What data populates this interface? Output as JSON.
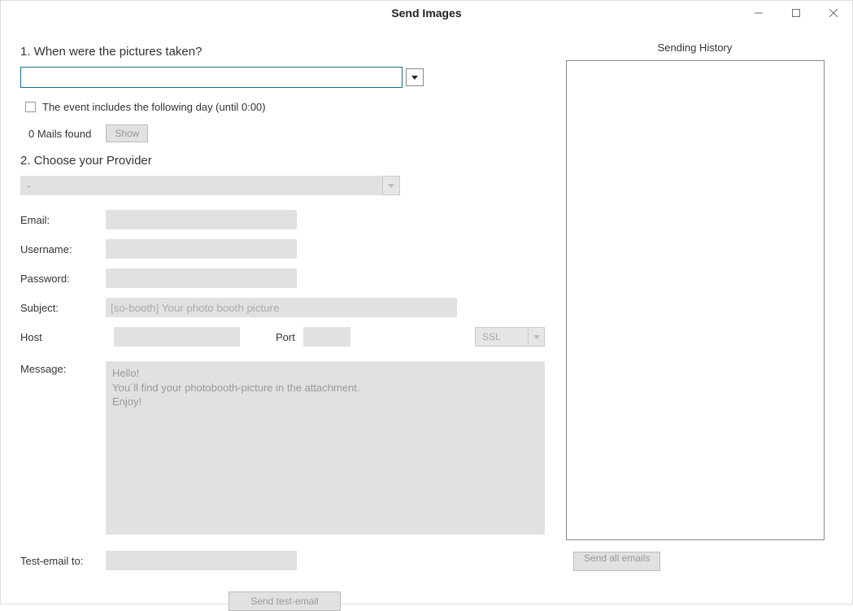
{
  "window": {
    "title": "Send Images"
  },
  "section1": {
    "heading": "1. When were the pictures taken?",
    "date_value": "",
    "include_next_day_label": "The event includes the following day (until 0:00)",
    "mails_found_text": "0 Mails found",
    "show_button": "Show"
  },
  "section2": {
    "heading": "2. Choose your Provider",
    "provider_value": "-"
  },
  "form": {
    "email_label": "Email:",
    "email_value": "",
    "username_label": "Username:",
    "username_value": "",
    "password_label": "Password:",
    "password_value": "",
    "subject_label": "Subject:",
    "subject_value": "[so-booth] Your photo booth picture",
    "host_label": "Host",
    "host_value": "",
    "port_label": "Port",
    "port_value": "",
    "ssl_value": "SSL",
    "message_label": "Message:",
    "message_value": "Hello!\nYou´ll find your photobooth-picture in the attachment.\nEnjoy!",
    "test_email_label": "Test-email to:",
    "test_email_value": ""
  },
  "buttons": {
    "send_test": "Send test-email",
    "send_all": "Send all emails"
  },
  "history": {
    "label": "Sending History"
  }
}
